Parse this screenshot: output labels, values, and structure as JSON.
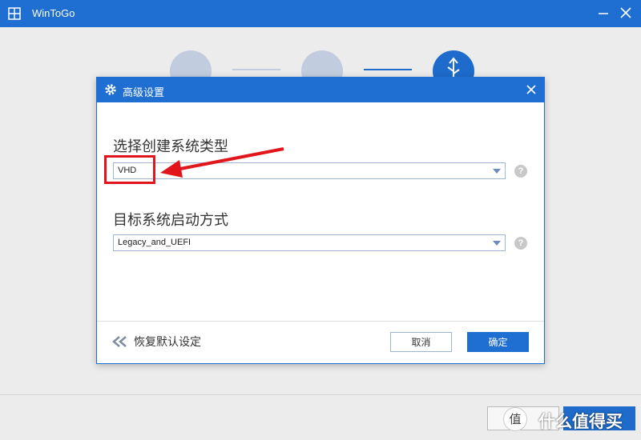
{
  "window": {
    "title": "WinToGo"
  },
  "dialog": {
    "title": "高级设置",
    "system_type": {
      "label": "选择创建系统类型",
      "value": "VHD"
    },
    "boot_mode": {
      "label": "目标系统启动方式",
      "value": "Legacy_and_UEFI"
    },
    "help_glyph": "?",
    "reset_label": "恢复默认设定",
    "cancel_label": "取消",
    "ok_label": "确定"
  },
  "watermark": {
    "icon_text": "值",
    "text": "什么值得买"
  },
  "colors": {
    "accent": "#1f6fd2",
    "annotation": "#e0161c"
  },
  "icons": [
    "windows-logo-icon",
    "minimize-icon",
    "close-icon",
    "gear-icon",
    "help-icon",
    "double-chevron-left-icon",
    "caret-down-icon",
    "usb-icon"
  ]
}
